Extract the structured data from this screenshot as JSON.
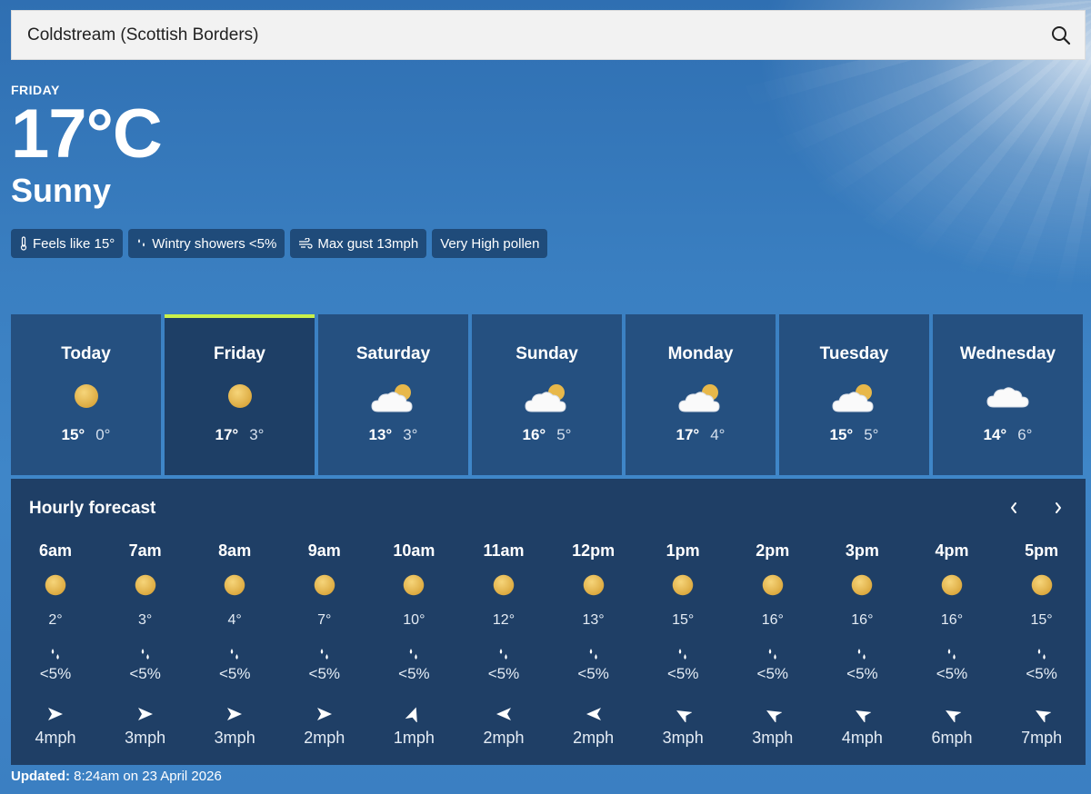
{
  "search": {
    "value": "Coldstream (Scottish Borders)",
    "icon": "search-icon"
  },
  "current": {
    "day": "FRIDAY",
    "temperature": "17°C",
    "condition": "Sunny",
    "chips": [
      {
        "icon": "thermometer-icon",
        "label": "Feels like 15°"
      },
      {
        "icon": "raindrops-icon",
        "label": "Wintry showers <5%"
      },
      {
        "icon": "wind-icon",
        "label": "Max gust 13mph"
      },
      {
        "icon": "",
        "label": "Very High pollen"
      }
    ]
  },
  "days": [
    {
      "name": "Today",
      "icon": "sun-icon",
      "high": "15°",
      "low": "0°",
      "selected": false
    },
    {
      "name": "Friday",
      "icon": "sun-icon",
      "high": "17°",
      "low": "3°",
      "selected": true
    },
    {
      "name": "Saturday",
      "icon": "sun-cloud-icon",
      "high": "13°",
      "low": "3°",
      "selected": false
    },
    {
      "name": "Sunday",
      "icon": "sun-cloud-icon",
      "high": "16°",
      "low": "5°",
      "selected": false
    },
    {
      "name": "Monday",
      "icon": "sun-cloud-icon",
      "high": "17°",
      "low": "4°",
      "selected": false
    },
    {
      "name": "Tuesday",
      "icon": "sun-cloud-icon",
      "high": "15°",
      "low": "5°",
      "selected": false
    },
    {
      "name": "Wednesday",
      "icon": "cloud-icon",
      "high": "14°",
      "low": "6°",
      "selected": false
    }
  ],
  "hourly": {
    "title": "Hourly forecast",
    "hours": [
      {
        "time": "6am",
        "icon": "sun-icon",
        "temp": "2°",
        "rain": "<5%",
        "wind_dir": "east",
        "wind": "4mph"
      },
      {
        "time": "7am",
        "icon": "sun-icon",
        "temp": "3°",
        "rain": "<5%",
        "wind_dir": "east",
        "wind": "3mph"
      },
      {
        "time": "8am",
        "icon": "sun-icon",
        "temp": "4°",
        "rain": "<5%",
        "wind_dir": "east",
        "wind": "3mph"
      },
      {
        "time": "9am",
        "icon": "sun-icon",
        "temp": "7°",
        "rain": "<5%",
        "wind_dir": "east",
        "wind": "2mph"
      },
      {
        "time": "10am",
        "icon": "sun-icon",
        "temp": "10°",
        "rain": "<5%",
        "wind_dir": "north",
        "wind": "1mph"
      },
      {
        "time": "11am",
        "icon": "sun-icon",
        "temp": "12°",
        "rain": "<5%",
        "wind_dir": "west",
        "wind": "2mph"
      },
      {
        "time": "12pm",
        "icon": "sun-icon",
        "temp": "13°",
        "rain": "<5%",
        "wind_dir": "west",
        "wind": "2mph"
      },
      {
        "time": "1pm",
        "icon": "sun-icon",
        "temp": "15°",
        "rain": "<5%",
        "wind_dir": "north-west",
        "wind": "3mph"
      },
      {
        "time": "2pm",
        "icon": "sun-icon",
        "temp": "16°",
        "rain": "<5%",
        "wind_dir": "north-west",
        "wind": "3mph"
      },
      {
        "time": "3pm",
        "icon": "sun-icon",
        "temp": "16°",
        "rain": "<5%",
        "wind_dir": "north-west",
        "wind": "4mph"
      },
      {
        "time": "4pm",
        "icon": "sun-icon",
        "temp": "16°",
        "rain": "<5%",
        "wind_dir": "north-west",
        "wind": "6mph"
      },
      {
        "time": "5pm",
        "icon": "sun-icon",
        "temp": "15°",
        "rain": "<5%",
        "wind_dir": "north-west",
        "wind": "7mph"
      }
    ]
  },
  "updated": {
    "label": "Updated:",
    "text": "8:24am on 23 April 2026"
  },
  "colors": {
    "selected_accent": "#c9f04a",
    "sun": "#e8b84a"
  }
}
